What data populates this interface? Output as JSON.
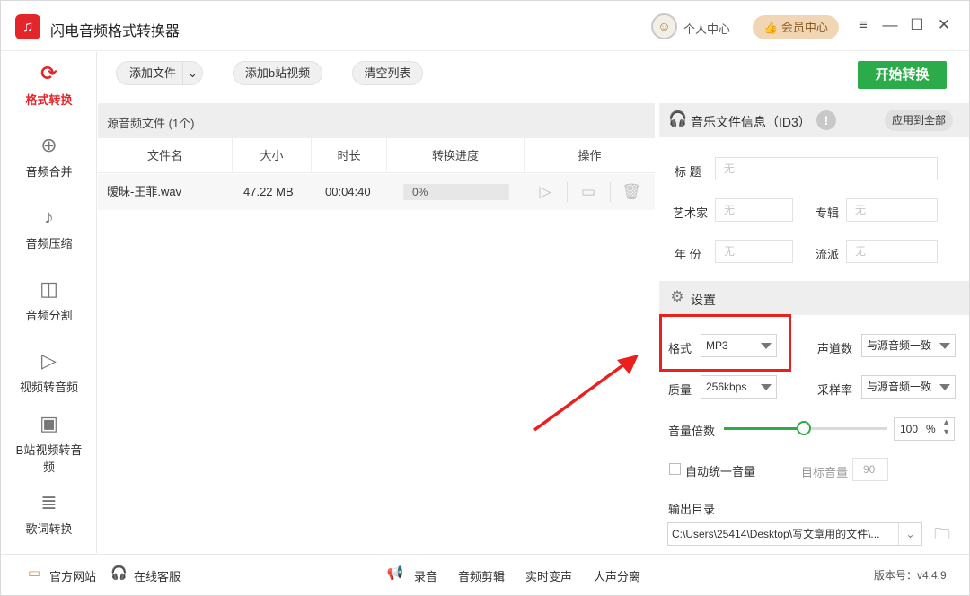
{
  "app": {
    "logo_glyph": "♫",
    "title": "闪电音频格式转换器"
  },
  "header": {
    "user_center": "个人中心",
    "vip_center": "会员中心",
    "vip_icon": "👍"
  },
  "sidebar": {
    "items": [
      {
        "label": "格式转换",
        "icon": "⟳",
        "active": true
      },
      {
        "label": "音频合并",
        "icon": "⊕"
      },
      {
        "label": "音频压缩",
        "icon": "♪"
      },
      {
        "label": "音频分割",
        "icon": "◫"
      },
      {
        "label": "视频转音频",
        "icon": "▷"
      },
      {
        "label_line1": "B站视频转音",
        "label_line2": "频",
        "icon": "▣"
      },
      {
        "label": "歌词转换",
        "icon": "≣"
      }
    ]
  },
  "toolbar": {
    "add_file": "添加文件",
    "add_bilibili": "添加b站视频",
    "clear_list": "清空列表",
    "start": "开始转换"
  },
  "file_list": {
    "title": "源音频文件 (1个)",
    "columns": [
      "文件名",
      "大小",
      "时长",
      "转换进度",
      "操作"
    ],
    "rows": [
      {
        "name": "暧昧-王菲.wav",
        "size": "47.22 MB",
        "duration": "00:04:40",
        "progress": "0%"
      }
    ]
  },
  "id3": {
    "title": "音乐文件信息（ID3）",
    "apply_all": "应用到全部",
    "info_glyph": "!",
    "title_label": "标 题",
    "artist_label": "艺术家",
    "album_label": "专辑",
    "year_label": "年 份",
    "genre_label": "流派",
    "placeholder": "无"
  },
  "settings": {
    "title": "设置",
    "format_label": "格式",
    "format_value": "MP3",
    "channels_label": "声道数",
    "channels_value": "与源音频一致",
    "quality_label": "质量",
    "quality_value": "256kbps",
    "samplerate_label": "采样率",
    "samplerate_value": "与源音频一致",
    "volume_label": "音量倍数",
    "volume_value": "100",
    "volume_unit": "%",
    "volume_fraction": 0.49,
    "auto_volume_label": "自动统一音量",
    "target_volume_label": "目标音量",
    "target_volume_value": "90",
    "output_dir_label": "输出目录",
    "output_dir_value": "C:\\Users\\25414\\Desktop\\写文章用的文件\\..."
  },
  "footer": {
    "website": "官方网站",
    "support": "在线客服",
    "record": "录音",
    "audio_edit": "音频剪辑",
    "realtime_voice": "实时变声",
    "vocal_split": "人声分离",
    "version": "版本号：v4.4.9"
  },
  "colors": {
    "accent": "#e3262a",
    "start": "#2cab4a",
    "highlight": "#e9201e"
  }
}
